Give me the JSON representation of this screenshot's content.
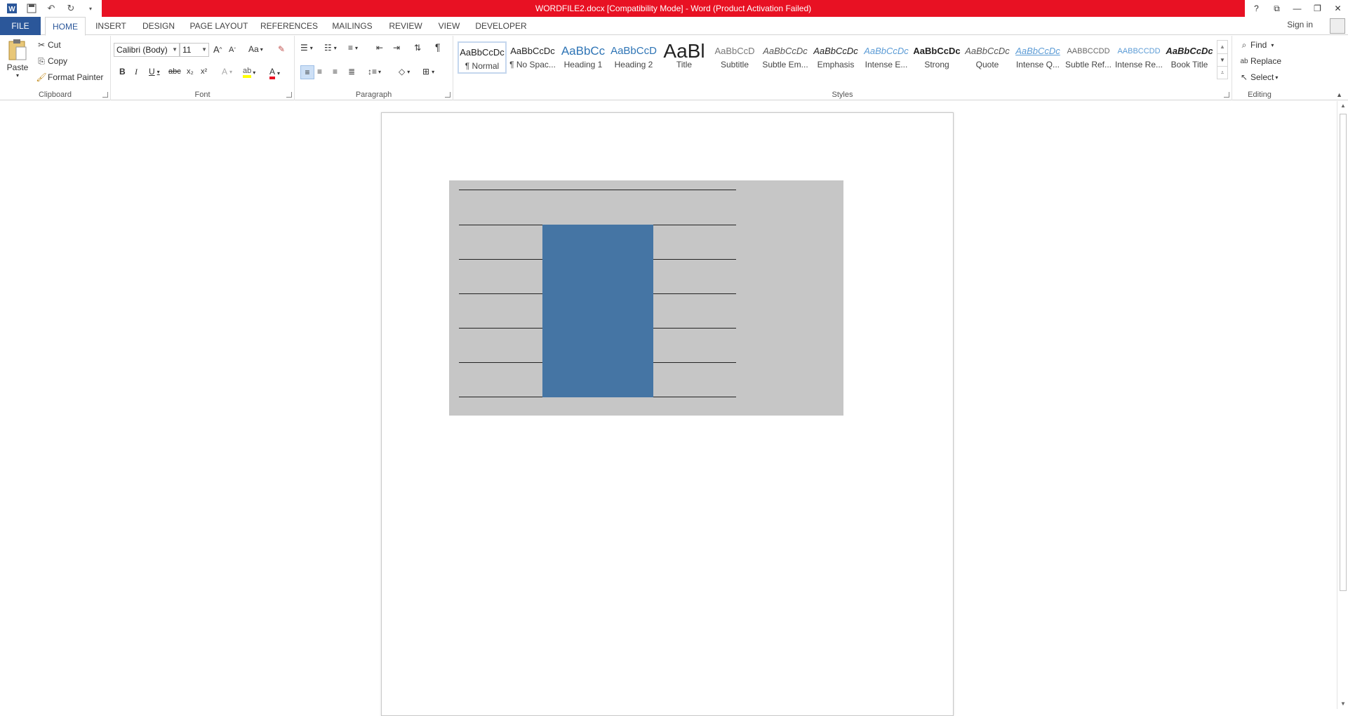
{
  "window": {
    "title": "WORDFILE2.docx [Compatibility Mode] - Word (Product Activation Failed)",
    "title_bar_color": "#e81123",
    "controls": [
      "?",
      "restore-ribbon",
      "minimize",
      "restore",
      "close"
    ]
  },
  "quick_access": {
    "icons": [
      "word-logo-icon",
      "save-icon",
      "undo-icon",
      "redo-icon",
      "customize-icon"
    ]
  },
  "tabs": {
    "items": [
      "FILE",
      "HOME",
      "INSERT",
      "DESIGN",
      "PAGE LAYOUT",
      "REFERENCES",
      "MAILINGS",
      "REVIEW",
      "VIEW",
      "DEVELOPER"
    ],
    "active": "HOME",
    "file_color": "#2b579a",
    "sign_in": "Sign in"
  },
  "ribbon": {
    "clipboard": {
      "label": "Clipboard",
      "paste": "Paste",
      "cut": "Cut",
      "copy": "Copy",
      "format_painter": "Format Painter"
    },
    "font": {
      "label": "Font",
      "font_name": "Calibri (Body)",
      "font_size": "11",
      "grow": "A",
      "shrink": "A",
      "change_case": "Aa",
      "bold": "B",
      "italic": "I",
      "underline": "U",
      "strike": "abc",
      "subscript": "x₂",
      "superscript": "x²",
      "text_effects": "A",
      "font_color": "A"
    },
    "paragraph": {
      "label": "Paragraph"
    },
    "styles": {
      "label": "Styles",
      "items": [
        {
          "sample": "AaBbCcDc",
          "name": "¶ Normal"
        },
        {
          "sample": "AaBbCcDc",
          "name": "¶ No Spac..."
        },
        {
          "sample": "AaBbCc",
          "name": "Heading 1"
        },
        {
          "sample": "AaBbCcD",
          "name": "Heading 2"
        },
        {
          "sample": "AaBl",
          "name": "Title"
        },
        {
          "sample": "AaBbCcD",
          "name": "Subtitle"
        },
        {
          "sample": "AaBbCcDc",
          "name": "Subtle Em..."
        },
        {
          "sample": "AaBbCcDc",
          "name": "Emphasis"
        },
        {
          "sample": "AaBbCcDc",
          "name": "Intense E..."
        },
        {
          "sample": "AaBbCcDc",
          "name": "Strong"
        },
        {
          "sample": "AaBbCcDc",
          "name": "Quote"
        },
        {
          "sample": "AaBbCcDc",
          "name": "Intense Q..."
        },
        {
          "sample": "AABBCCDD",
          "name": "Subtle Ref..."
        },
        {
          "sample": "AABBCCDD",
          "name": "Intense Re..."
        },
        {
          "sample": "AaBbCcDc",
          "name": "Book Title"
        }
      ]
    },
    "editing": {
      "label": "Editing",
      "find": "Find",
      "replace": "Replace",
      "select": "Select"
    }
  },
  "document": {
    "panel_color": "#c6c6c6",
    "bar_color": "#4575a4"
  }
}
